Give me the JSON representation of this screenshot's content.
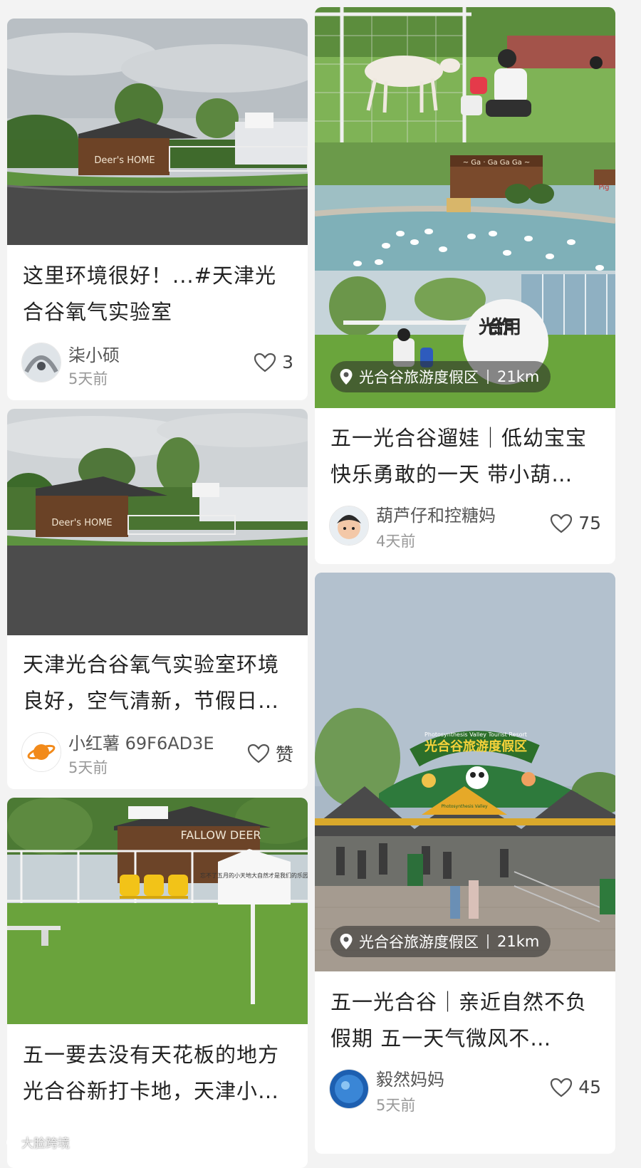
{
  "feed": {
    "left": [
      {
        "title": "这里环境很好！...#天津光合谷氧气实验室",
        "author": "柒小硕",
        "time": "5天前",
        "likes": "3"
      },
      {
        "title": "天津光合谷氧气实验室环境良好，空气清新，节假日…",
        "author": "小红薯 69F6AD3E",
        "time": "5天前",
        "likes": "赞"
      },
      {
        "title": "五一要去没有天花板的地方 光合谷新打卡地，天津小…",
        "author": "",
        "time": "",
        "likes": ""
      }
    ],
    "right": [
      {
        "title": "五一光合谷遛娃｜低幼宝宝快乐勇敢的一天 带小葫…",
        "author": "葫芦仔和控糖妈",
        "time": "4天前",
        "likes": "75",
        "location": "光合谷旅游度假区",
        "distance": "21km"
      },
      {
        "title": "五一光合谷｜亲近自然不负假期 五一天气微风不…",
        "author": "毅然妈妈",
        "time": "5天前",
        "likes": "45",
        "location": "光合谷旅游度假区",
        "distance": "21km"
      }
    ]
  },
  "photo_text": {
    "deer_home_sign": "Deer's HOME",
    "fallow_deer_sign": "FALLOW DEER",
    "ga_sign": "~ Ga · Ga Ga Ga ~",
    "pig_sign": "Pig",
    "balloon_text": "光合作用",
    "gate_sign": "光合谷旅游度假区",
    "gate_sign_en": "Photosynthesis Valley Tourist Resort",
    "gate_small": "Photosynthesis Valley",
    "board_text": "忘不了五月的小天地大自然才是我们的乐园"
  },
  "watermark": "大脸跨境",
  "colors": {
    "accent": "#ff2442",
    "grass": "#6fa83e",
    "sky": "#c9d2d6",
    "wood": "#6b4228"
  }
}
